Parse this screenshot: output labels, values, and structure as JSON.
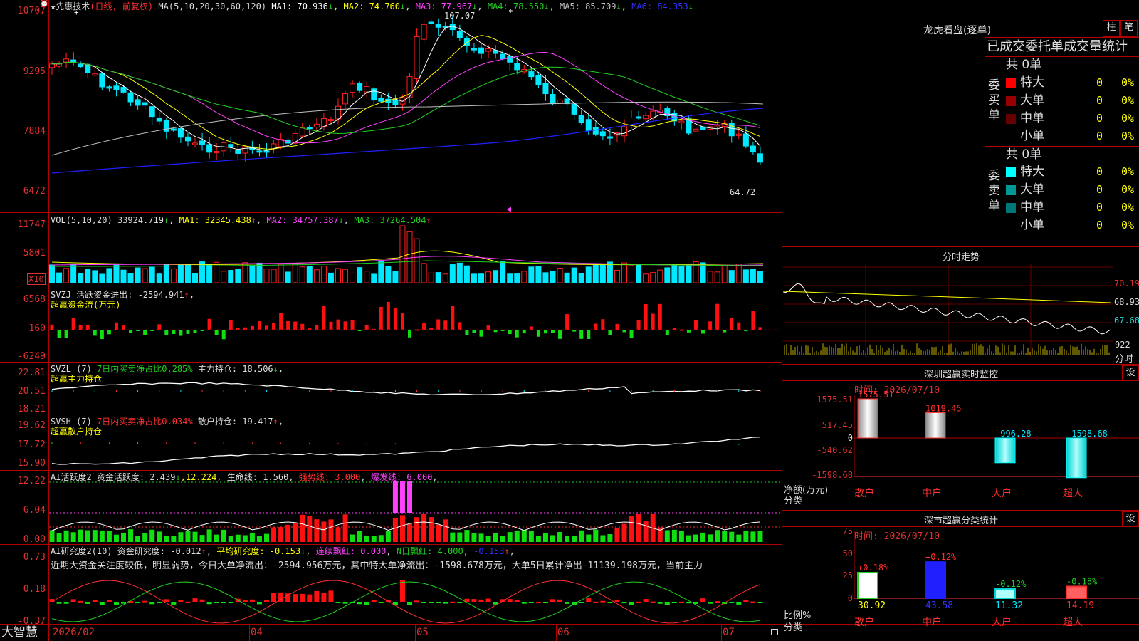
{
  "app": {
    "brand": "大智慧",
    "alarm_icon": "alarm-clock-icon"
  },
  "main_chart": {
    "header": {
      "star": "★",
      "name": "先惠技术",
      "period": "(日线, 前复权)",
      "ma_label": "MA(5,10,20,30,60,120)",
      "ma1": "MA1: 70.936",
      "ma2": "MA2: 74.760",
      "ma3": "MA3: 77.967",
      "ma4": "MA4: 78.550",
      "ma5": "MA5: 85.709",
      "ma6": "MA6: 84.353",
      "down": "↓"
    },
    "y_labels": [
      "10707",
      "9295",
      "7884",
      "6472"
    ],
    "high_marker": "107.07",
    "low_marker": "64.72",
    "colors": {
      "up": "#ff2020",
      "down": "#00e8ff",
      "ma1": "#ffffff",
      "ma2": "#ffff00",
      "ma3": "#ff40ff",
      "ma4": "#20d020",
      "ma5": "#c0c0c0",
      "ma6": "#2020ff"
    }
  },
  "volume": {
    "legend": "VOL(5,10,20)",
    "value": "33924.719",
    "ma1": "MA1: 32345.438",
    "ma2": "MA2: 34757.387",
    "ma3": "MA3: 37264.504",
    "arrow_down": "↓",
    "arrow_up": "↑",
    "y_labels": [
      "11747",
      "5801"
    ],
    "unit": "X10"
  },
  "svzj": {
    "legend": "SVZJ  活跃资金进出: -2594.941",
    "arrow": "↑",
    "comma": ",",
    "subtitle": "超赢资金流(万元)",
    "y_labels": [
      "6568",
      "160",
      "-6249"
    ]
  },
  "svzl": {
    "legend": "SVZL (7)",
    "ratio": "7日内买卖净占比0.285%",
    "hold": "主力持仓: 18.506",
    "arrow": "↓",
    "comma": ",",
    "subtitle": "超赢主力持仓",
    "y_labels": [
      "22.81",
      "20.51",
      "18.21"
    ]
  },
  "svsh": {
    "legend": "SVSH (7)",
    "ratio": "7日内买卖净占比0.034%",
    "hold": "散户持仓: 19.417",
    "arrow": "↑",
    "comma": ",",
    "subtitle": "超赢散户持仓",
    "y_labels": [
      "19.62",
      "17.72",
      "15.90"
    ]
  },
  "ai1": {
    "legend": "AI活跃度2 资金活跃度: 2.439",
    "arrow": "↓",
    "v2": ",12.224",
    "v3": ", 生命线: 1.560",
    "strong": "强势线: 3.000",
    "burst": "爆发线: 6.000",
    "comma": ",",
    "y_labels": [
      "12.22",
      "6.04",
      "0.00"
    ]
  },
  "ai2": {
    "legend": "AI研究度2(10) 资金研究度: -0.012",
    "arrow1": "↑",
    "avg": "平均研究度: -0.153",
    "arrow2": "↓",
    "cont": "连续飘红: 0.000",
    "nday": "N日飘红: 4.000",
    "last": "-0.153",
    "arrow3": "↑",
    "comma": ",",
    "commentary": "近期大资金关注度较低，明显弱势，今日大单净流出：-2594.956万元，其中特大单净流出：-1598.678万元，大单5日累计净出-11139.198万元，当前主力",
    "y_labels": [
      "0.73",
      "0.18",
      "-0.37"
    ]
  },
  "x_labels": [
    "2026/02",
    "04",
    "05",
    "06",
    "07"
  ],
  "longhu": {
    "title": "龙虎看盘(逐单)",
    "btn_column": "柱",
    "btn_stroke": "笔",
    "tabs": "已成交委托单成交量统计",
    "buy": {
      "side": "委买单",
      "total": "共 0单",
      "rows": [
        {
          "label": "特大",
          "value": "0",
          "pct": "0%",
          "color": "#ff0000"
        },
        {
          "label": "大单",
          "value": "0",
          "pct": "0%",
          "color": "#990000"
        },
        {
          "label": "中单",
          "value": "0",
          "pct": "0%",
          "color": "#660000"
        },
        {
          "label": "小单",
          "value": "0",
          "pct": "0%",
          "color": "#000000"
        }
      ]
    },
    "sell": {
      "side": "委卖单",
      "total": "共 0单",
      "rows": [
        {
          "label": "特大",
          "value": "0",
          "pct": "0%",
          "color": "#00ffff"
        },
        {
          "label": "大单",
          "value": "0",
          "pct": "0%",
          "color": "#009999"
        },
        {
          "label": "中单",
          "value": "0",
          "pct": "0%",
          "color": "#007777"
        },
        {
          "label": "小单",
          "value": "0",
          "pct": "0%",
          "color": "#000000"
        }
      ]
    }
  },
  "fenshi": {
    "title": "分时走势",
    "y_labels": [
      "70.19",
      "68.93",
      "67.68"
    ],
    "vol_label": "922",
    "unit": "分时"
  },
  "sz_monitor": {
    "title": "深圳超赢实时监控",
    "settings": "设",
    "time": "时间: 2026/07/10",
    "y_labels": [
      "1575.51",
      "517.45",
      "0",
      "-540.62",
      "-1598.68"
    ],
    "y_title": "净额(万元)",
    "x_title": "分类",
    "chart_data": {
      "type": "bar",
      "categories": [
        "散户",
        "中户",
        "大户",
        "超大"
      ],
      "values": [
        1575.51,
        1019.45,
        -996.28,
        -1598.68
      ],
      "labels": [
        "1575.51",
        "1019.45",
        "-996.28",
        "-1598.68"
      ],
      "ylim": [
        -1598.68,
        1575.51
      ]
    }
  },
  "sz_class": {
    "title": "深市超赢分类统计",
    "settings": "设",
    "time": "时间: 2026/07/10",
    "y_labels": [
      "75",
      "50",
      "25",
      "0"
    ],
    "y_title": "比例%",
    "x_title": "分类",
    "chart_data": {
      "type": "bar",
      "categories": [
        "散户",
        "中户",
        "大户",
        "超大"
      ],
      "values": [
        30.92,
        43.58,
        11.32,
        14.19
      ],
      "changes": [
        "+0.18%",
        "+0.12%",
        "-0.12%",
        "-0.18%"
      ],
      "labels": [
        "30.92",
        "43.58",
        "11.32",
        "14.19"
      ],
      "ylim": [
        0,
        75
      ]
    }
  }
}
